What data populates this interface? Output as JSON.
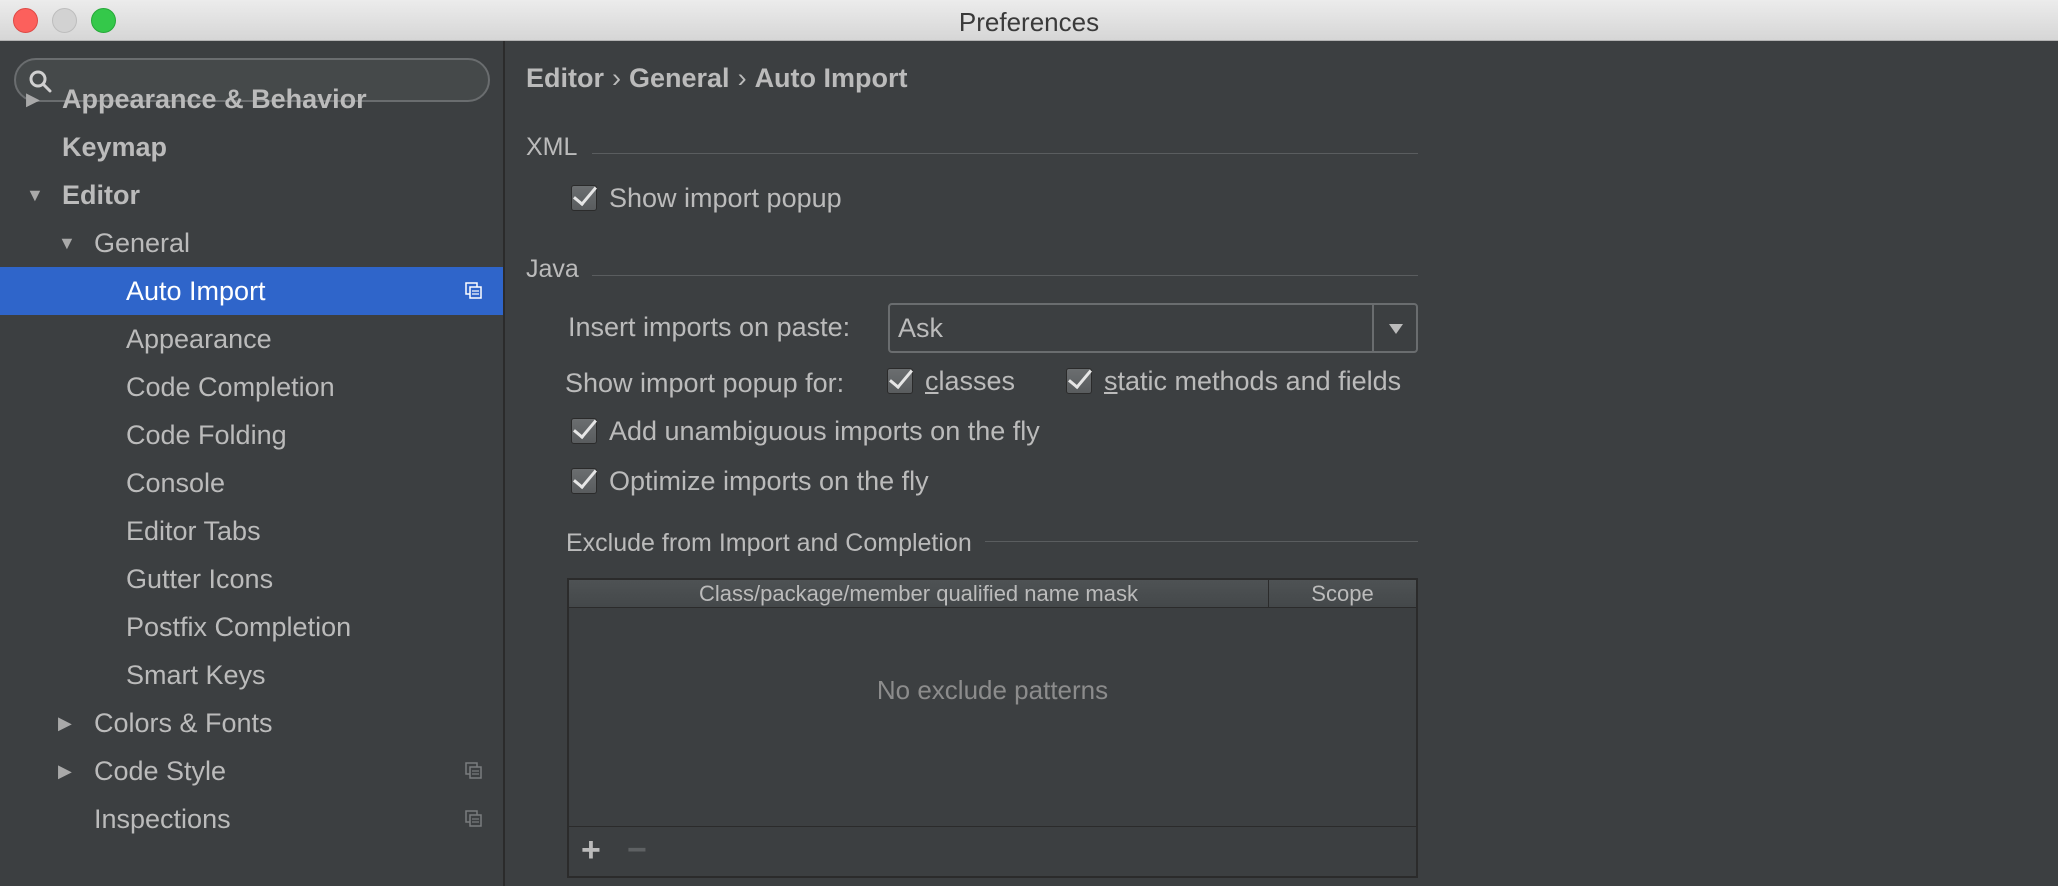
{
  "window": {
    "title": "Preferences"
  },
  "sidebar": {
    "search_placeholder": "",
    "items": [
      {
        "label": "Appearance & Behavior"
      },
      {
        "label": "Keymap"
      },
      {
        "label": "Editor"
      },
      {
        "label": "General"
      },
      {
        "label": "Auto Import",
        "selected": true
      },
      {
        "label": "Appearance"
      },
      {
        "label": "Code Completion"
      },
      {
        "label": "Code Folding"
      },
      {
        "label": "Console"
      },
      {
        "label": "Editor Tabs"
      },
      {
        "label": "Gutter Icons"
      },
      {
        "label": "Postfix Completion"
      },
      {
        "label": "Smart Keys"
      },
      {
        "label": "Colors & Fonts"
      },
      {
        "label": "Code Style"
      },
      {
        "label": "Inspections"
      }
    ]
  },
  "breadcrumb": [
    "Editor",
    "General",
    "Auto Import"
  ],
  "xml": {
    "title": "XML",
    "show_import_popup": {
      "label": "Show import popup",
      "checked": true
    }
  },
  "java": {
    "title": "Java",
    "insert_imports_label": "Insert imports on paste:",
    "insert_imports_value": "Ask",
    "show_popup_for_label": "Show import popup for:",
    "classes": {
      "label_underlined": "c",
      "label_rest": "lasses",
      "checked": true
    },
    "static_methods": {
      "label_underlined": "s",
      "label_rest": "tatic methods and fields",
      "checked": true
    },
    "add_unambiguous": {
      "label": "Add unambiguous imports on the fly",
      "checked": true
    },
    "optimize_imports": {
      "label": "Optimize imports on the fly",
      "checked": true
    }
  },
  "exclude": {
    "title": "Exclude from Import and Completion",
    "columns": [
      "Class/package/member qualified name mask",
      "Scope"
    ],
    "empty_text": "No exclude patterns",
    "add_label": "+",
    "remove_label": "−"
  },
  "colors": {
    "selection": "#2f65ca",
    "background": "#3c3f41",
    "text": "#bbbbbb"
  }
}
